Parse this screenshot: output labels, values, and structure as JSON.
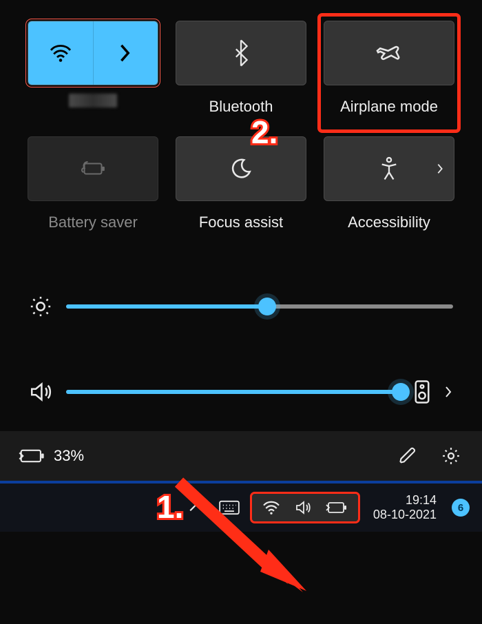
{
  "tiles": {
    "wifi": {
      "label": ""
    },
    "bluetooth": {
      "label": "Bluetooth"
    },
    "airplane": {
      "label": "Airplane mode"
    },
    "battery": {
      "label": "Battery saver"
    },
    "focus": {
      "label": "Focus assist"
    },
    "accessibility": {
      "label": "Accessibility"
    }
  },
  "sliders": {
    "brightness": {
      "percent": 52
    },
    "volume": {
      "percent": 100
    }
  },
  "footer": {
    "battery_text": "33%"
  },
  "annotations": {
    "step1": "1.",
    "step2": "2."
  },
  "taskbar": {
    "time": "19:14",
    "date": "08-10-2021",
    "notif_count": "6"
  },
  "colors": {
    "accent": "#4cc2ff",
    "highlight": "#ff2d18"
  }
}
